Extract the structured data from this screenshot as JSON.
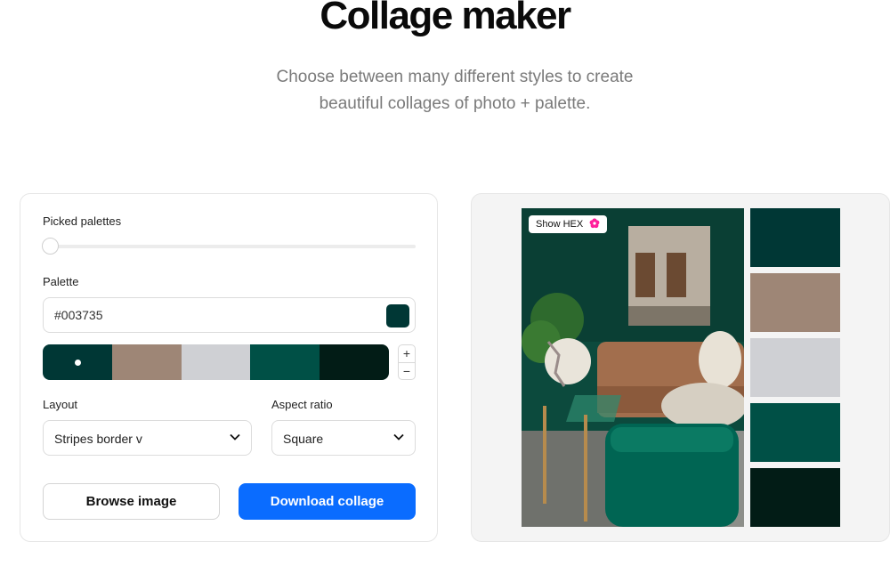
{
  "header": {
    "title": "Collage maker",
    "subtitle_line1": "Choose between many different styles to create",
    "subtitle_line2": "beautiful collages of photo + palette."
  },
  "controls": {
    "picked_palettes_label": "Picked palettes",
    "picked_palettes_value": 0,
    "palette_label": "Palette",
    "hex_value": "#003735",
    "palette_colors": [
      "#003735",
      "#9e8676",
      "#cfd0d4",
      "#005046",
      "#021c16"
    ],
    "selected_color_index": 0,
    "stepper_plus": "+",
    "stepper_minus": "−",
    "layout_label": "Layout",
    "layout_value": "Stripes border v",
    "aspect_label": "Aspect ratio",
    "aspect_value": "Square",
    "browse_label": "Browse image",
    "download_label": "Download collage"
  },
  "preview": {
    "show_hex_label": "Show HEX",
    "swatches": [
      "#003735",
      "#9e8676",
      "#cfd0d4",
      "#005046",
      "#021c16"
    ]
  },
  "colors": {
    "accent": "#0a6cff",
    "flower": "#ff1f9b"
  },
  "icons": [
    "chevron-down-icon",
    "flower-icon",
    "plus-icon",
    "minus-icon"
  ]
}
